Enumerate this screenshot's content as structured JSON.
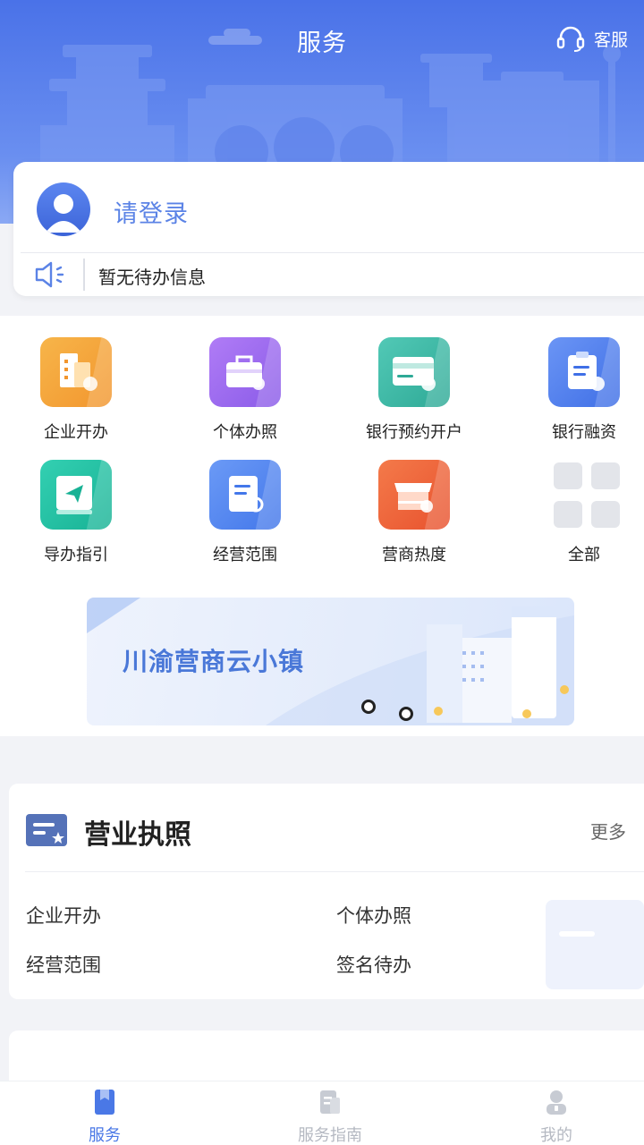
{
  "header": {
    "title": "服务",
    "customer_service": "客服"
  },
  "login": {
    "prompt": "请登录",
    "notice": "暂无待办信息"
  },
  "grid": {
    "items": [
      {
        "label": "企业开办",
        "color": "#f5a23b"
      },
      {
        "label": "个体办照",
        "color": "#9b6ef0"
      },
      {
        "label": "银行预约开户",
        "color": "#36b8a6"
      },
      {
        "label": "银行融资",
        "color": "#4d7ef0"
      },
      {
        "label": "导办指引",
        "color": "#27c4a8"
      },
      {
        "label": "经营范围",
        "color": "#4e86f2"
      },
      {
        "label": "营商热度",
        "color": "#f0663c"
      },
      {
        "label": "全部",
        "color": "#e3e5ea"
      }
    ]
  },
  "banner": {
    "text": "川渝营商云小镇"
  },
  "license": {
    "title": "营业执照",
    "more": "更多",
    "links": [
      "企业开办",
      "个体办照",
      "经营范围",
      "签名待办"
    ]
  },
  "tabbar": {
    "tabs": [
      {
        "label": "服务",
        "active": true
      },
      {
        "label": "服务指南",
        "active": false
      },
      {
        "label": "我的",
        "active": false
      }
    ]
  }
}
